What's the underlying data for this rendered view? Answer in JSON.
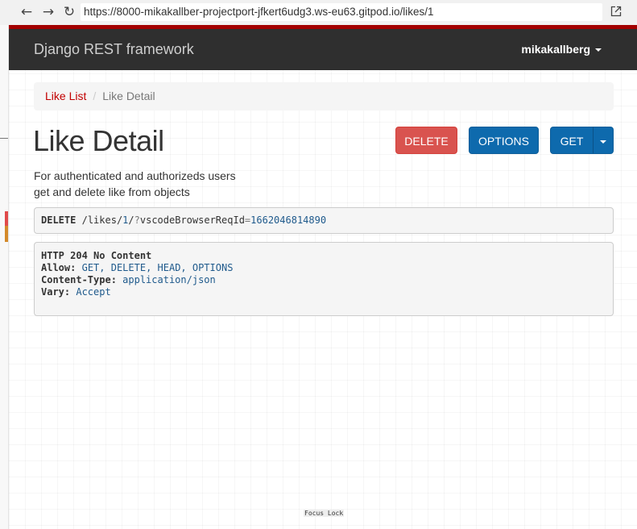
{
  "browser": {
    "url": "https://8000-mikakallber-projectport-jfkert6udg3.ws-eu63.gitpod.io/likes/1",
    "back_glyph": "←",
    "forward_glyph": "→",
    "reload_glyph": "↻"
  },
  "navbar": {
    "brand": "Django REST framework",
    "user": "mikakallberg"
  },
  "breadcrumb": {
    "items": [
      {
        "label": "Like List"
      },
      {
        "label": "Like Detail"
      }
    ],
    "separator": "/"
  },
  "page": {
    "title": "Like Detail",
    "description_lines": [
      "For authenticated and authorizeds users",
      "get and delete like from objects"
    ]
  },
  "buttons": {
    "delete": "DELETE",
    "options": "OPTIONS",
    "get": "GET"
  },
  "request": {
    "method": "DELETE",
    "path_prefix": "/likes/",
    "path_id": "1",
    "path_sep": "/",
    "query_mark": "?",
    "query_key": "vscodeBrowserReqId",
    "query_eq": "=",
    "query_value": "1662046814890"
  },
  "response": {
    "status": "HTTP 204 No Content",
    "headers": [
      {
        "name": "Allow:",
        "value": "GET, DELETE, HEAD, OPTIONS"
      },
      {
        "name": "Content-Type:",
        "value": "application/json"
      },
      {
        "name": "Vary:",
        "value": "Accept"
      }
    ]
  },
  "footer": {
    "focus_lock": "Focus Lock"
  },
  "colors": {
    "navbar_bg": "#2f2f2f",
    "navbar_accent": "#a30000",
    "delete_button": "#d9534f",
    "primary_button": "#0e6aad",
    "link": "#c20000",
    "gutter_red": "#e04a4a",
    "gutter_orange": "#d48a2a"
  },
  "icons": {
    "back": "arrow-left-icon",
    "forward": "arrow-right-icon",
    "reload": "reload-icon",
    "open_external": "open-external-icon",
    "dropdown": "caret-down-icon"
  }
}
